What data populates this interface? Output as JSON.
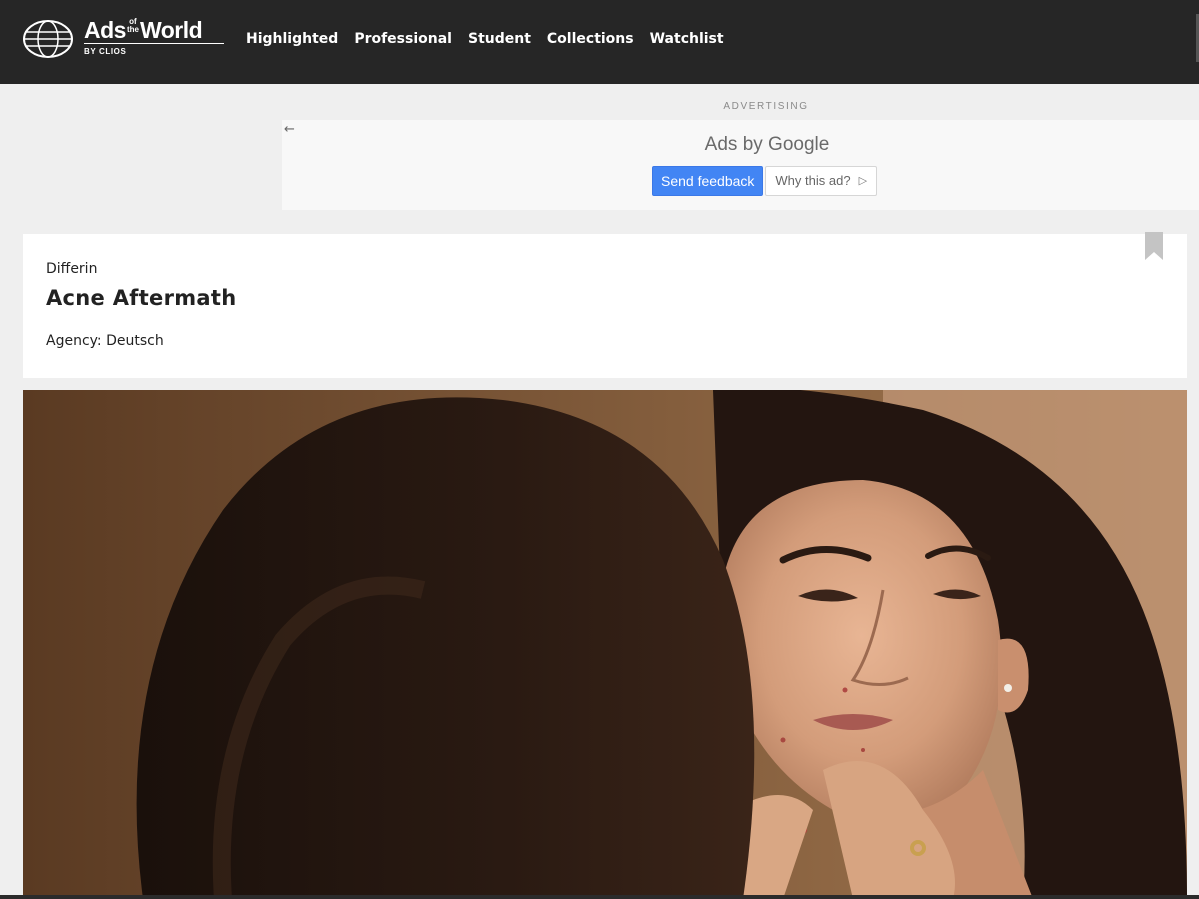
{
  "header": {
    "logo": {
      "wordmark_left": "Ads",
      "wordmark_of": "of",
      "wordmark_the": "the",
      "wordmark_right": "World",
      "byline": "BY CLIOS"
    },
    "nav": [
      {
        "label": "Highlighted"
      },
      {
        "label": "Professional"
      },
      {
        "label": "Student"
      },
      {
        "label": "Collections"
      },
      {
        "label": "Watchlist"
      }
    ],
    "background": "#262626"
  },
  "advertising": {
    "label": "ADVERTISING",
    "brand_prefix": "Ads by ",
    "brand_name": "Google",
    "send_feedback": "Send feedback",
    "why_this_ad": "Why this ad?",
    "feedback_color": "#4285f4",
    "back_icon": "arrow-left-icon",
    "adchoices_icon": "adchoices-icon"
  },
  "ad_card": {
    "brand": "Differin",
    "title": "Acne Aftermath",
    "agency_line": "Agency: Deutsch",
    "bookmark_icon": "bookmark-icon"
  },
  "media": {
    "type": "video still"
  }
}
